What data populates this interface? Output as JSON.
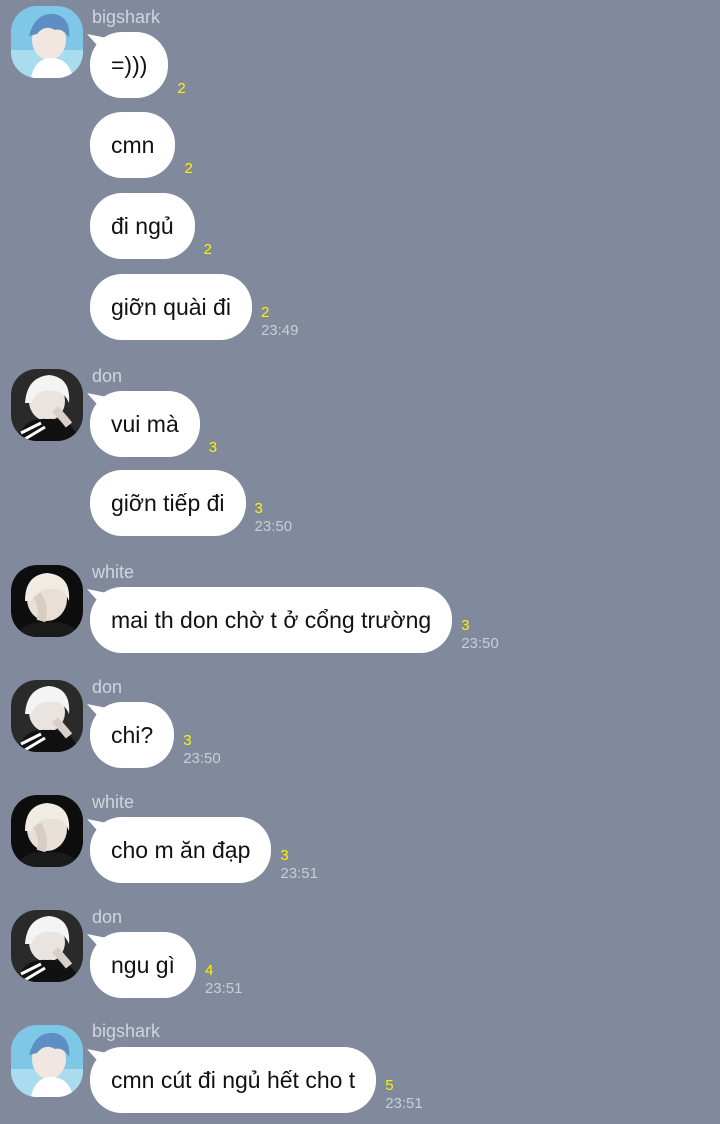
{
  "colors": {
    "background": "#808a9c",
    "bubble": "#ffffff",
    "read_count": "#fff200",
    "meta_text": "#c8ced8"
  },
  "groups": [
    {
      "sender": "bigshark",
      "avatar": "avatar-bigshark",
      "messages": [
        {
          "text": "=)))",
          "read": "2",
          "time": ""
        },
        {
          "text": "cmn",
          "read": "2",
          "time": ""
        },
        {
          "text": "đi ngủ",
          "read": "2",
          "time": ""
        },
        {
          "text": "giỡn quài đi",
          "read": "2",
          "time": "23:49"
        }
      ]
    },
    {
      "sender": "don",
      "avatar": "avatar-don",
      "messages": [
        {
          "text": "vui mà",
          "read": "3",
          "time": ""
        },
        {
          "text": "giỡn tiếp đi",
          "read": "3",
          "time": "23:50"
        }
      ]
    },
    {
      "sender": "white",
      "avatar": "avatar-white",
      "messages": [
        {
          "text": "mai th don chờ t ở cổng trường",
          "read": "3",
          "time": "23:50"
        }
      ]
    },
    {
      "sender": "don",
      "avatar": "avatar-don",
      "messages": [
        {
          "text": "chi?",
          "read": "3",
          "time": "23:50"
        }
      ]
    },
    {
      "sender": "white",
      "avatar": "avatar-white",
      "messages": [
        {
          "text": "cho m ăn đạp",
          "read": "3",
          "time": "23:51"
        }
      ]
    },
    {
      "sender": "don",
      "avatar": "avatar-don",
      "messages": [
        {
          "text": "ngu gì",
          "read": "4",
          "time": "23:51"
        }
      ]
    },
    {
      "sender": "bigshark",
      "avatar": "avatar-bigshark",
      "messages": [
        {
          "text": "cmn cút đi ngủ hết cho t",
          "read": "5",
          "time": "23:51"
        }
      ]
    }
  ]
}
